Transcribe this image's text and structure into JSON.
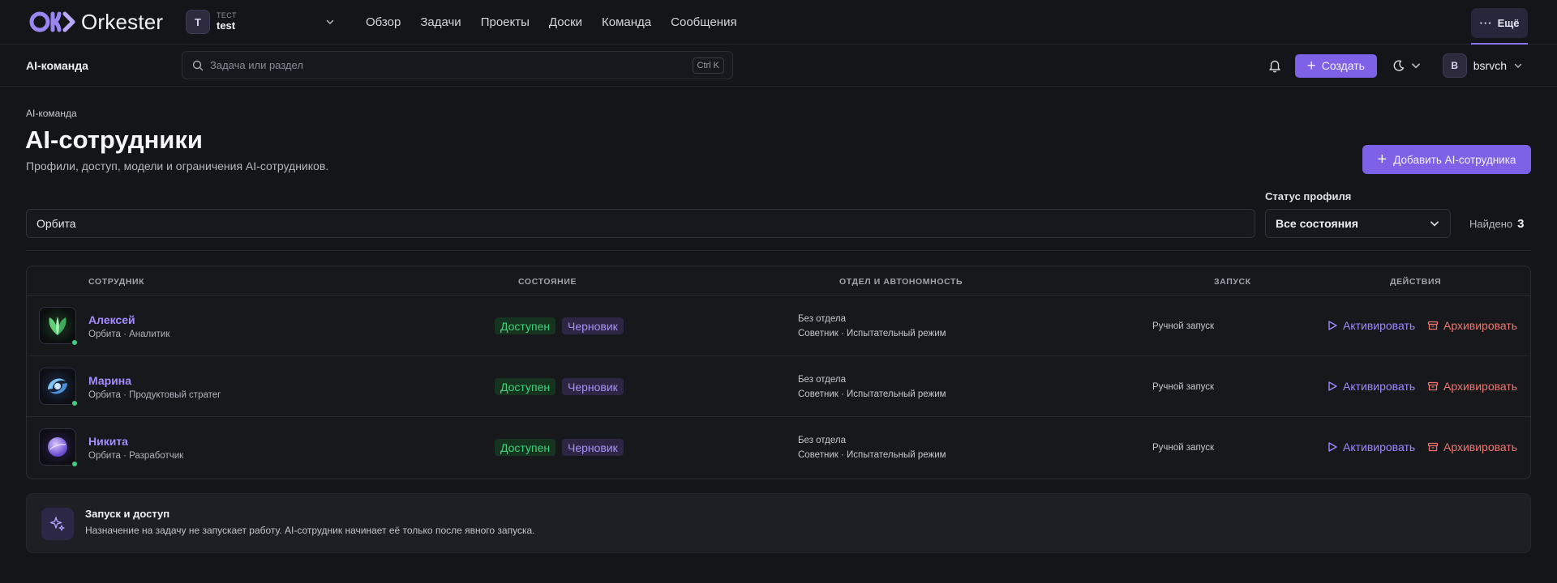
{
  "app": {
    "name": "Orkester"
  },
  "workspace": {
    "label": "ТЕСТ",
    "name": "test",
    "initial": "T"
  },
  "nav": {
    "items": [
      "Обзор",
      "Задачи",
      "Проекты",
      "Доски",
      "Команда",
      "Сообщения"
    ],
    "more_label": "Ещё"
  },
  "subbar": {
    "section": "AI-команда",
    "search_placeholder": "Задача или раздел",
    "shortcut": "Ctrl K",
    "create_label": "Создать",
    "user": {
      "initial": "B",
      "name": "bsrvch"
    }
  },
  "page": {
    "breadcrumb": "AI-команда",
    "title": "AI-сотрудники",
    "subtitle": "Профили, доступ, модели и ограничения AI-сотрудников.",
    "add_button": "Добавить AI-сотрудника"
  },
  "filters": {
    "query": "Орбита",
    "status_label": "Статус профиля",
    "status_value": "Все состояния",
    "found_label": "Найдено",
    "found_count": "3"
  },
  "table": {
    "headers": {
      "employee": "Сотрудник",
      "state": "Состояние",
      "dept": "Отдел и автономность",
      "launch": "Запуск",
      "actions": "Действия"
    },
    "rows": [
      {
        "name": "Алексей",
        "sub": "Орбита · Аналитик",
        "status": "Доступен",
        "stage": "Черновик",
        "dept": "Без отдела",
        "autonomy": "Советник · Испытательный режим",
        "launch": "Ручной запуск",
        "activate": "Активировать",
        "archive": "Архивировать"
      },
      {
        "name": "Марина",
        "sub": "Орбита · Продуктовый стратег",
        "status": "Доступен",
        "stage": "Черновик",
        "dept": "Без отдела",
        "autonomy": "Советник · Испытательный режим",
        "launch": "Ручной запуск",
        "activate": "Активировать",
        "archive": "Архивировать"
      },
      {
        "name": "Никита",
        "sub": "Орбита · Разработчик",
        "status": "Доступен",
        "stage": "Черновик",
        "dept": "Без отдела",
        "autonomy": "Советник · Испытательный режим",
        "launch": "Ручной запуск",
        "activate": "Активировать",
        "archive": "Архивировать"
      }
    ]
  },
  "info": {
    "title": "Запуск и доступ",
    "text": "Назначение на задачу не запускает работу. AI-сотрудник начинает её только после явного запуска."
  },
  "colors": {
    "accent": "#7d62e8",
    "success": "#42d27c",
    "danger": "#f0766f",
    "background": "#141519"
  }
}
